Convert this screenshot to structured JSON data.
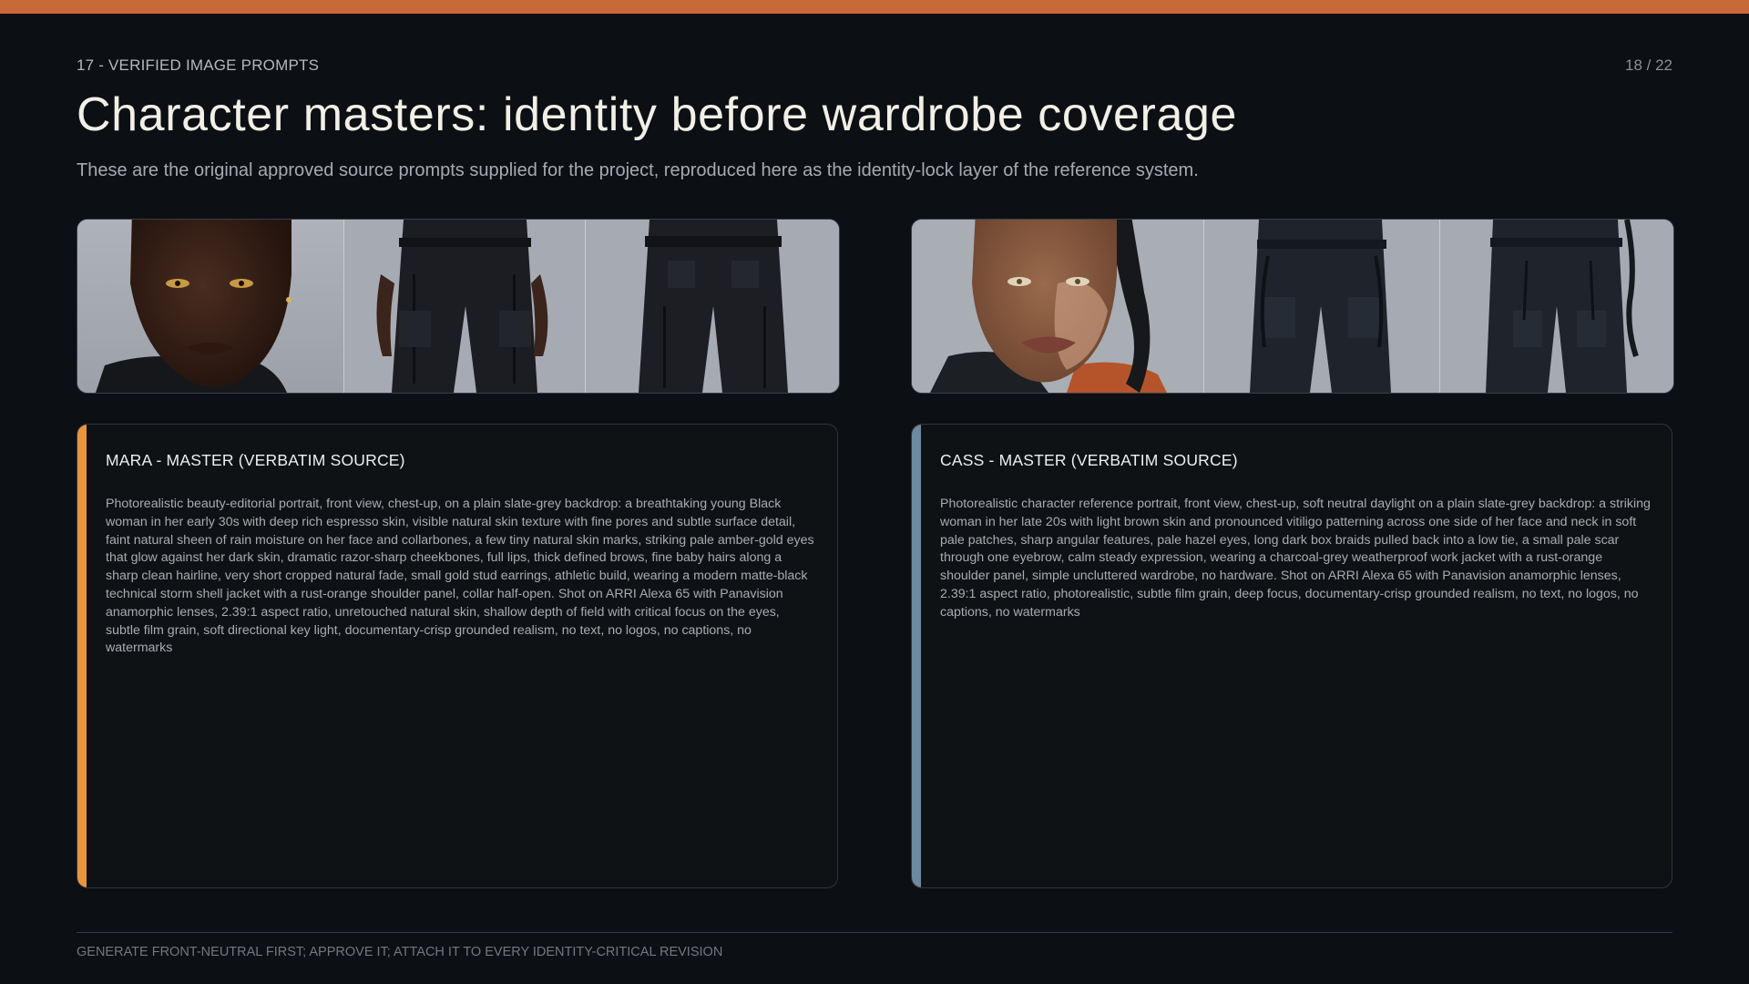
{
  "colors": {
    "top_bar": "#c8693a",
    "mara_accent": "#e9963a",
    "cass_accent": "#6e8aa1"
  },
  "header": {
    "eyebrow": "17 - VERIFIED IMAGE PROMPTS",
    "page_number": "18 / 22",
    "title": "Character masters: identity before wardrobe coverage",
    "subtitle": "These are the original approved source prompts supplied for the project, reproduced here as the identity-lock layer of the reference system."
  },
  "strips": {
    "mara": [
      "face-portrait",
      "front-trousers",
      "back-trousers"
    ],
    "cass": [
      "face-portrait",
      "front-trousers",
      "back-trousers"
    ]
  },
  "cards": {
    "mara": {
      "title": "MARA - MASTER (VERBATIM SOURCE)",
      "body": "Photorealistic beauty-editorial portrait, front view, chest-up, on a plain slate-grey backdrop: a breathtaking young Black woman in her early 30s with deep rich espresso skin, visible natural skin texture with fine pores and subtle surface detail, faint natural sheen of rain moisture on her face and collarbones, a few tiny natural skin marks, striking pale amber-gold eyes that glow against her dark skin, dramatic razor-sharp cheekbones, full lips, thick defined brows, fine baby hairs along a sharp clean hairline, very short cropped natural fade, small gold stud earrings, athletic build, wearing a modern matte-black technical storm shell jacket with a rust-orange shoulder panel, collar half-open. Shot on ARRI Alexa 65 with Panavision anamorphic lenses, 2.39:1 aspect ratio, unretouched natural skin, shallow depth of field with critical focus on the eyes, subtle film grain, soft directional key light, documentary-crisp grounded realism, no text, no logos, no captions, no watermarks"
    },
    "cass": {
      "title": "CASS - MASTER (VERBATIM SOURCE)",
      "body": "Photorealistic character reference portrait, front view, chest-up, soft neutral daylight on a plain slate-grey backdrop: a striking woman in her late 20s with light brown skin and pronounced vitiligo patterning across one side of her face and neck in soft pale patches, sharp angular features, pale hazel eyes, long dark box braids pulled back into a low tie, a small pale scar through one eyebrow, calm steady expression, wearing a charcoal-grey weatherproof work jacket with a rust-orange shoulder panel, simple uncluttered wardrobe, no hardware. Shot on ARRI Alexa 65 with Panavision anamorphic lenses, 2.39:1 aspect ratio, photorealistic, subtle film grain, deep focus, documentary-crisp grounded realism, no text, no logos, no captions, no watermarks"
    }
  },
  "footer": {
    "note": "GENERATE FRONT-NEUTRAL FIRST; APPROVE IT; ATTACH IT TO EVERY IDENTITY-CRITICAL REVISION"
  }
}
